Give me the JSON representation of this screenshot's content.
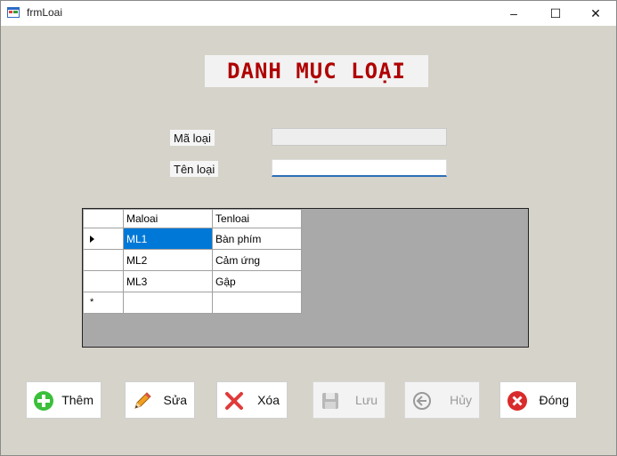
{
  "window": {
    "title": "frmLoai",
    "minimize": "–",
    "maximize": "☐",
    "close": "✕"
  },
  "heading": "DANH MỤC LOẠI",
  "form": {
    "ma_loai_label": "Mã loại",
    "ma_loai_value": "",
    "ten_loai_label": "Tên loại",
    "ten_loai_value": ""
  },
  "grid": {
    "columns": [
      "Maloai",
      "Tenloai"
    ],
    "rows": [
      {
        "maloai": "ML1",
        "tenloai": "Bàn phím"
      },
      {
        "maloai": "ML2",
        "tenloai": "Cảm ứng"
      },
      {
        "maloai": "ML3",
        "tenloai": "Gập"
      }
    ],
    "new_row_marker": "*"
  },
  "buttons": {
    "them": "Thêm",
    "sua": "Sửa",
    "xoa": "Xóa",
    "luu": "Lưu",
    "huy": "Hủy",
    "dong": "Đóng"
  },
  "icons": {
    "them": "add-icon",
    "sua": "pencil-icon",
    "xoa": "delete-x-icon",
    "luu": "save-disk-icon",
    "huy": "back-arrow-icon",
    "dong": "close-circle-icon"
  },
  "colors": {
    "heading": "#b00000",
    "selection": "#0078d7",
    "grid_background": "#a9a9a9"
  }
}
